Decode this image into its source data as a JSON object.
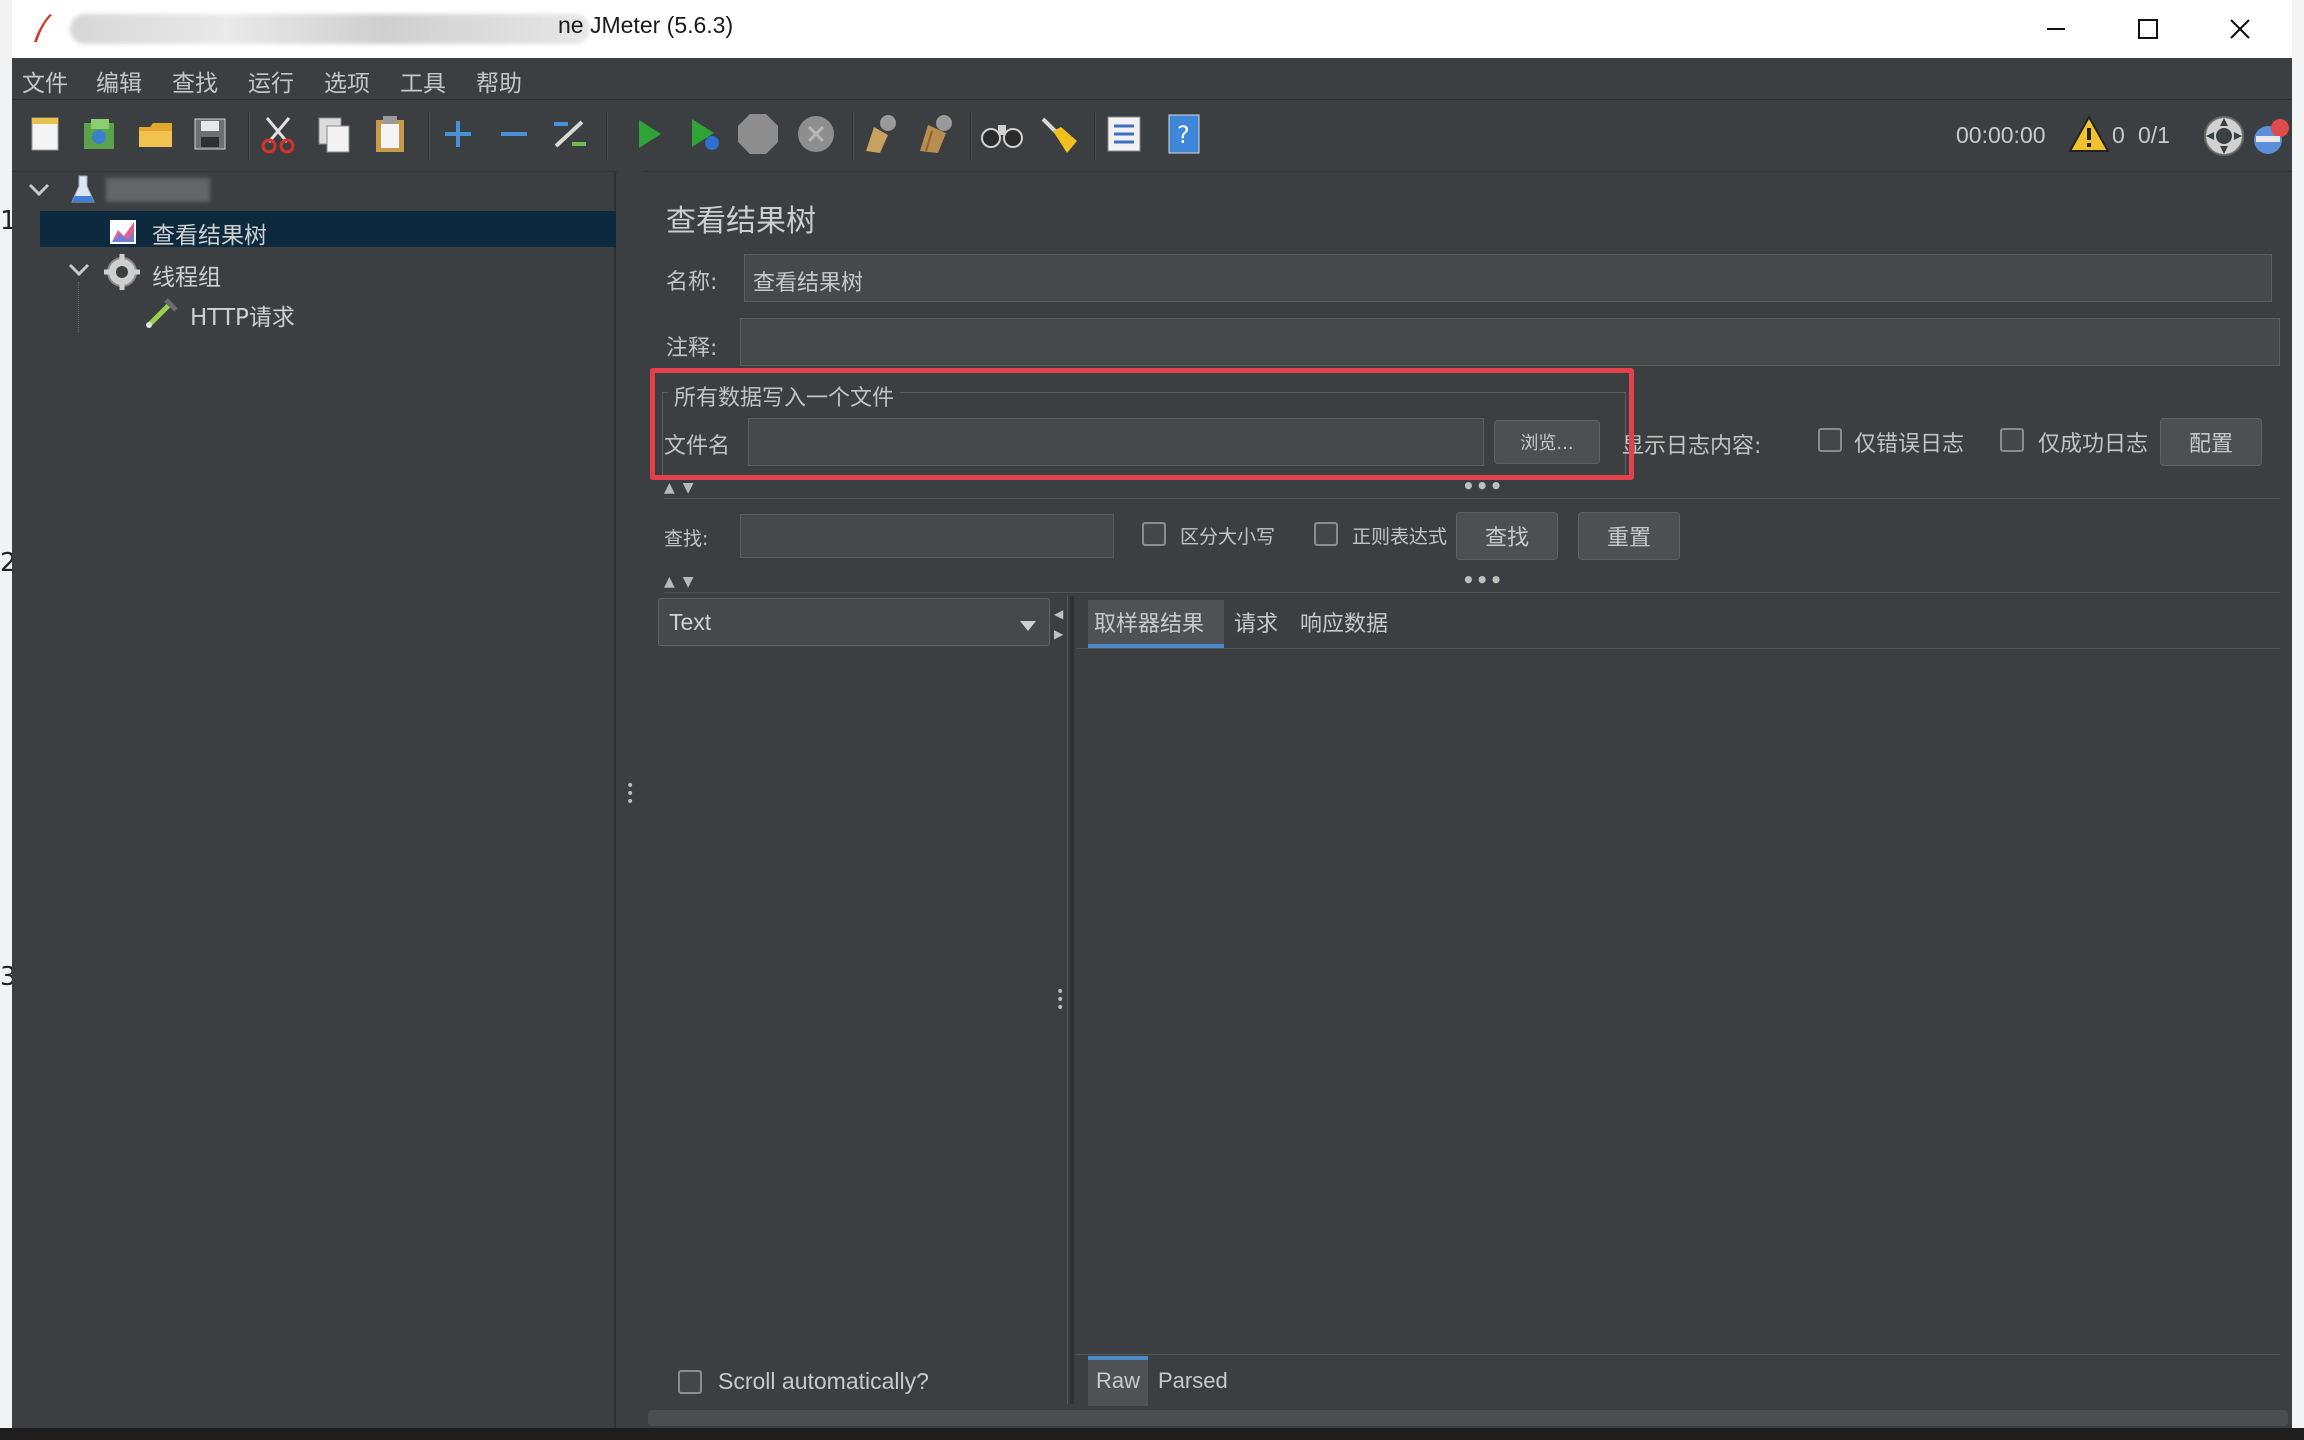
{
  "window": {
    "title": "ne JMeter (5.6.3)",
    "minimize_icon": "minimize-icon",
    "maximize_icon": "maximize-icon",
    "close_icon": "close-icon"
  },
  "menu": [
    "文件",
    "编辑",
    "查找",
    "运行",
    "选项",
    "工具",
    "帮助"
  ],
  "toolbar": {
    "icons": [
      "new-icon",
      "templates-icon",
      "open-icon",
      "save-icon",
      "cut-icon",
      "copy-icon",
      "paste-icon",
      "expand-icon",
      "collapse-icon",
      "toggle-icon",
      "start-icon",
      "start-no-pause-icon",
      "stop-icon",
      "shutdown-icon",
      "clear-icon",
      "clear-all-icon",
      "search-icon",
      "reset-search-icon",
      "function-helper-icon",
      "help-icon"
    ],
    "timer": "00:00:00",
    "warning_count": "0",
    "threads": "0/1"
  },
  "tree": {
    "root_label": "",
    "items": [
      {
        "label": "查看结果树",
        "icon": "chart-icon",
        "selected": true
      },
      {
        "label": "线程组",
        "icon": "gear-icon"
      },
      {
        "label": "HTTP请求",
        "icon": "pipette-icon"
      }
    ]
  },
  "panel": {
    "title": "查看结果树",
    "name_label": "名称:",
    "name_value": "查看结果树",
    "comment_label": "注释:",
    "comment_value": "",
    "file_section_title": "所有数据写入一个文件",
    "filename_label": "文件名",
    "filename_value": "",
    "browse_button": "浏览...",
    "log_label": "显示日志内容:",
    "errors_only": "仅错误日志",
    "success_only": "仅成功日志",
    "configure_button": "配置",
    "search_label": "查找:",
    "search_value": "",
    "case_sensitive": "区分大小写",
    "regex": "正则表达式",
    "find_button": "查找",
    "reset_button": "重置",
    "renderer_select": "Text",
    "tabs": [
      "取样器结果",
      "请求",
      "响应数据"
    ],
    "scroll_auto": "Scroll automatically?",
    "bottom_tabs": [
      "Raw",
      "Parsed"
    ]
  },
  "edge_marks": [
    "1",
    "2",
    "3"
  ],
  "colors": {
    "background": "#3c3f41",
    "selection": "#0d293e",
    "highlight_box": "#e4414a",
    "accent": "#4a88c7"
  }
}
